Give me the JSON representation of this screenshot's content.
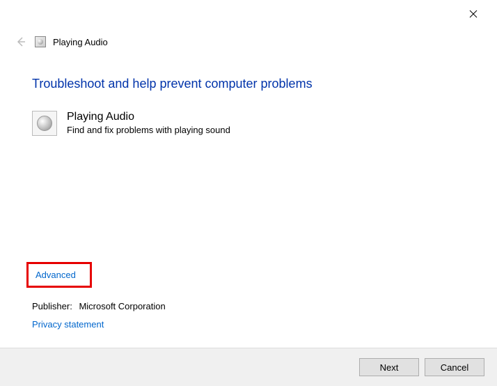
{
  "window": {
    "title": "Playing Audio"
  },
  "heading": "Troubleshoot and help prevent computer problems",
  "troubleshooter": {
    "name": "Playing Audio",
    "description": "Find and fix problems with playing sound"
  },
  "links": {
    "advanced": "Advanced",
    "privacy": "Privacy statement"
  },
  "publisher": {
    "label": "Publisher:",
    "value": "Microsoft Corporation"
  },
  "buttons": {
    "next": "Next",
    "cancel": "Cancel"
  }
}
